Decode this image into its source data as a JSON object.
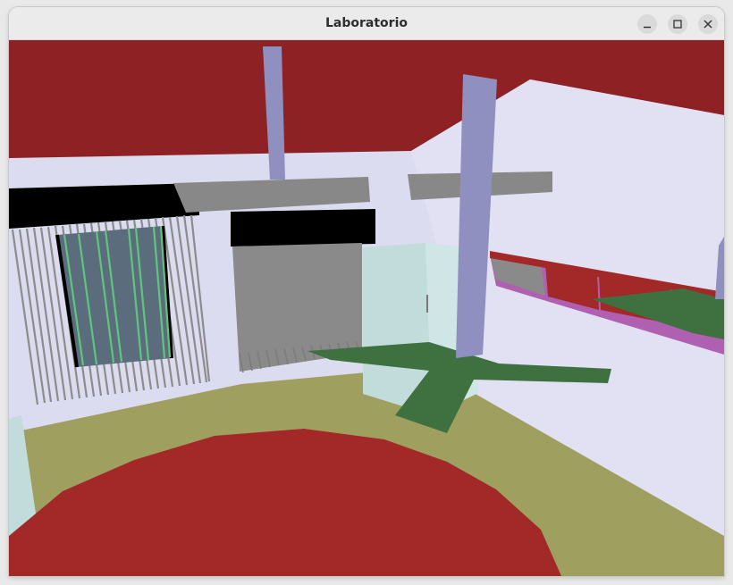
{
  "window": {
    "title": "Laboratorio",
    "controls": [
      {
        "name": "minimize-button",
        "icon": "minimize-icon"
      },
      {
        "name": "maximize-button",
        "icon": "maximize-icon"
      },
      {
        "name": "close-button",
        "icon": "close-icon"
      }
    ]
  },
  "scene": {
    "description_colors": {
      "ceiling": "#8e2124",
      "walls": "#dcdcf0",
      "floor": "#9f9f5f",
      "rug": "#a32828",
      "desk": "#3f7040",
      "pillar": "#9090c0",
      "beam": "#888888",
      "blinds": "#8a8a8a",
      "window_frame": "#000000",
      "cabinet": "#c2dcdc",
      "shelf": "#b060b0"
    }
  }
}
